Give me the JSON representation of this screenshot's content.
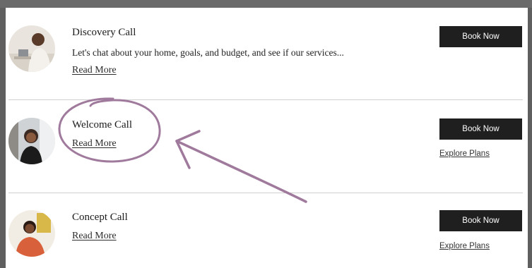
{
  "services": [
    {
      "title": "Discovery Call",
      "description": "Let's chat about your home, goals, and budget, and see if our services...",
      "read_more": "Read More",
      "book_label": "Book Now",
      "explore_label": ""
    },
    {
      "title": "Welcome Call",
      "description": "",
      "read_more": "Read More",
      "book_label": "Book Now",
      "explore_label": "Explore Plans"
    },
    {
      "title": "Concept Call",
      "description": "",
      "read_more": "Read More",
      "book_label": "Book Now",
      "explore_label": "Explore Plans"
    }
  ],
  "annotation": {
    "color": "#a07a9c",
    "shapes": [
      "circle-highlight",
      "arrow"
    ]
  },
  "colors": {
    "button_bg": "#1f1f1f",
    "button_text": "#ffffff",
    "outer_bg": "#5f5f5f"
  }
}
